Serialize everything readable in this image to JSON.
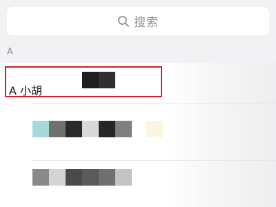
{
  "search": {
    "placeholder": "搜索"
  },
  "section": {
    "letter": "A"
  },
  "contacts": [
    {
      "label": "A 小胡",
      "highlighted": true
    }
  ],
  "colors": {
    "highlight_border": "#d41f2a",
    "background": "#f2f2f4",
    "placeholder_text": "#8e8e93"
  },
  "redacted_rows": [
    {
      "blocks": [
        "#a8d8dc",
        "#707070",
        "#2a2a2a",
        "#d8d8d8",
        "#262626",
        "#808080"
      ]
    },
    {
      "blocks": [
        "#8a8a8a",
        "#d4d4d4",
        "#4a4a4a",
        "#5a5a5a",
        "#707070",
        "#c4c4c4"
      ]
    }
  ]
}
